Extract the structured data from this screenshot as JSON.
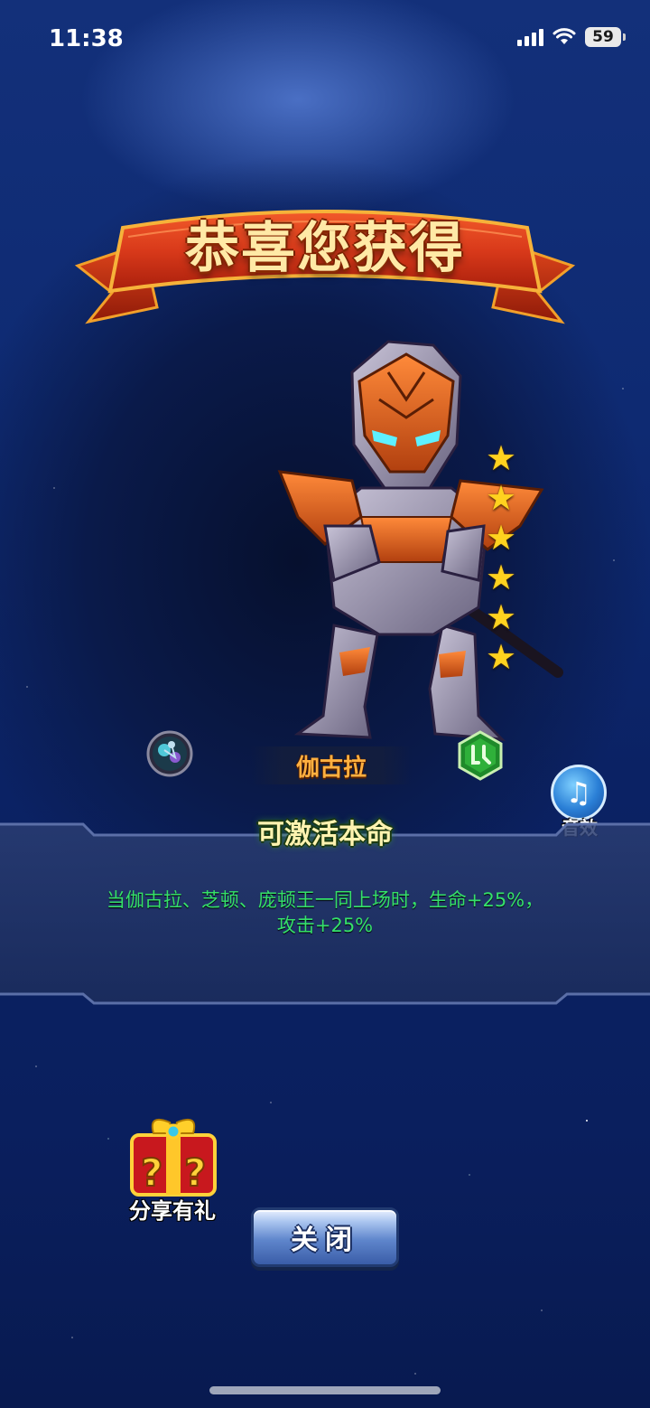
{
  "status_bar": {
    "time": "11:38",
    "battery": "59"
  },
  "banner": {
    "title": "恭喜您获得"
  },
  "hero": {
    "name": "伽古拉",
    "stars": 6
  },
  "sound": {
    "label": "音效"
  },
  "panel": {
    "title": "可激活本命",
    "description_line1": "当伽古拉、芝顿、庞顿王一同上场时，生命+25%，",
    "description_line2": "攻击+25%"
  },
  "gift": {
    "label": "分享有礼"
  },
  "close": {
    "label": "关闭"
  },
  "colors": {
    "desc_text": "#35e06a",
    "name_text": "#ffb040",
    "banner_red": "#d8391a",
    "star": "#ffd21f"
  }
}
